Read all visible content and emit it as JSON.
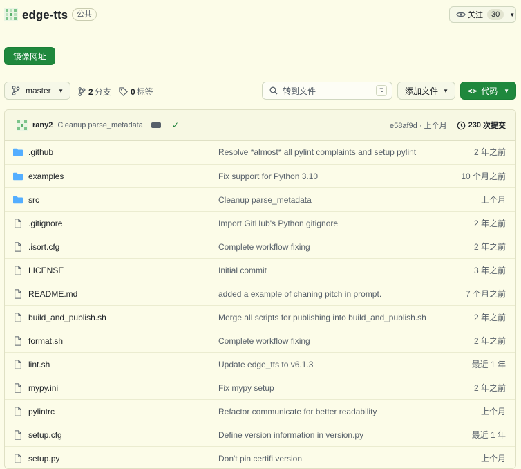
{
  "repo": {
    "name": "edge-tts",
    "visibility": "公共"
  },
  "watch": {
    "label": "关注",
    "count": "30"
  },
  "mirror_button": "镜像网址",
  "branch": {
    "current": "master",
    "branches_count": "2",
    "branches_label": "分支",
    "tags_count": "0",
    "tags_label": "标签"
  },
  "search": {
    "placeholder": "转到文件",
    "shortcut": "t"
  },
  "add_file": "添加文件",
  "code_button": "代码",
  "latest_commit": {
    "author": "rany2",
    "message": "Cleanup parse_metadata",
    "sha": "e58af9d",
    "time": "上个月",
    "history_count": "230",
    "history_label": "次提交"
  },
  "files": [
    {
      "name": ".github",
      "type": "dir",
      "message": "Resolve *almost* all pylint complaints and setup pylint",
      "time": "2 年之前"
    },
    {
      "name": "examples",
      "type": "dir",
      "message": "Fix support for Python 3.10",
      "time": "10 个月之前"
    },
    {
      "name": "src",
      "type": "dir",
      "message": "Cleanup parse_metadata",
      "time": "上个月"
    },
    {
      "name": ".gitignore",
      "type": "file",
      "message": "Import GitHub's Python gitignore",
      "time": "2 年之前"
    },
    {
      "name": ".isort.cfg",
      "type": "file",
      "message": "Complete workflow fixing",
      "time": "2 年之前"
    },
    {
      "name": "LICENSE",
      "type": "file",
      "message": "Initial commit",
      "time": "3 年之前"
    },
    {
      "name": "README.md",
      "type": "file",
      "message": "added a example of chaning pitch in prompt.",
      "time": "7 个月之前"
    },
    {
      "name": "build_and_publish.sh",
      "type": "file",
      "message": "Merge all scripts for publishing into build_and_publish.sh",
      "time": "2 年之前"
    },
    {
      "name": "format.sh",
      "type": "file",
      "message": "Complete workflow fixing",
      "time": "2 年之前"
    },
    {
      "name": "lint.sh",
      "type": "file",
      "message": "Update edge_tts to v6.1.3",
      "time": "最近 1 年"
    },
    {
      "name": "mypy.ini",
      "type": "file",
      "message": "Fix mypy setup",
      "time": "2 年之前"
    },
    {
      "name": "pylintrc",
      "type": "file",
      "message": "Refactor communicate for better readability",
      "time": "上个月"
    },
    {
      "name": "setup.cfg",
      "type": "file",
      "message": "Define version information in version.py",
      "time": "最近 1 年"
    },
    {
      "name": "setup.py",
      "type": "file",
      "message": "Don't pin certifi version",
      "time": "上个月"
    }
  ],
  "colors": {
    "accent_green": "#1f883d",
    "folder_blue": "#54aeff",
    "background": "#fcfce8"
  }
}
